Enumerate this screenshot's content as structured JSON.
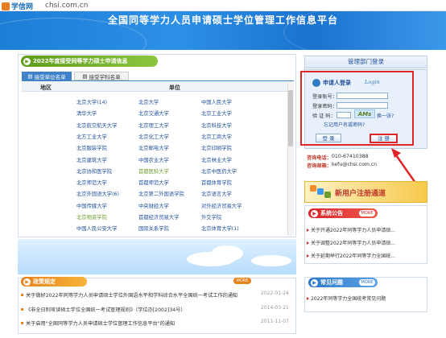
{
  "site": {
    "logo_text": "学信网",
    "domain": "chsi.com.cn"
  },
  "banner": {
    "title": "全国同等学力人员申请硕士学位管理工作信息平台"
  },
  "notice_tab": "2022年度接受同等学力硕士申请信息",
  "tabs": [
    {
      "label": "接受单位名单"
    },
    {
      "label": "接受学科名单"
    }
  ],
  "table": {
    "headers": [
      "地区",
      "单位"
    ],
    "universities": [
      "北京大学(14)",
      "北京大学",
      "中国人民大学",
      "清华大学",
      "北京交通大学",
      "北京工业大学",
      "北京航空航天大学",
      "北京理工大学",
      "北京科技大学",
      "北方工业大学",
      "北京化工大学",
      "北京工商大学",
      "北京服装学院",
      "北京邮电大学",
      "北京印刷学院",
      "北京建筑大学",
      "中国农业大学",
      "北京林业大学",
      "北京协和医学院",
      "首都医科大学",
      "北京中医药大学",
      "北京师范大学",
      "首都师范大学",
      "首都体育学院",
      "北京外国语大学(6)",
      "北京第二外国语学院",
      "北京语言大学",
      "中国传媒大学",
      "中央财经大学",
      "对外经济贸易大学",
      "北京物资学院",
      "首都经济贸易大学",
      "外交学院",
      "中国人民公安大学",
      "国际关系学院",
      "北京体育大学(1)"
    ]
  },
  "policy": {
    "title": "政策规定",
    "more": "MORE",
    "items": [
      {
        "text": "关于做好2022年同等学力人员申请硕士学位外国语水平和学科综合水平全国统一考试工作的通知",
        "date": "2022-01-24"
      },
      {
        "text": "《非全日制攻读硕士学位全国统一考试管理规则》（学位办[2002]34号）",
        "date": "2014-03-21"
      },
      {
        "text": "关于启用\"全国同等学力人员申请硕士学位管理工作信息平台\"的通知",
        "date": "2011-11-07"
      }
    ]
  },
  "login": {
    "header": "管理部门登录",
    "title": "申请人登录",
    "title_en": "Login",
    "account_label": "登录账号：",
    "password_label": "登录密码：",
    "captcha_label": "验 证 码：",
    "captcha_text": "AMs",
    "swap": "换一张?",
    "forgot": "忘记用户名或密码?",
    "login_button": "登 录",
    "register_button": "注 册"
  },
  "contact": {
    "phone_label": "咨询电话：",
    "phone": "010-67410388",
    "email_label": "咨询邮箱：",
    "email": "kefu@chsi.com.cn"
  },
  "register_banner": "新用户注册通道",
  "system_notice": {
    "title": "系统公告",
    "more": "MORE",
    "items": [
      "关于开通2022年同等学力人员申请硕...",
      "关于调整2022年同等学力人员申请硕...",
      "关于延期举行2022年同等学力全国统..."
    ]
  },
  "faq": {
    "title": "常见问题",
    "more": "MORE",
    "items": [
      "2022年同等学力全国统考常见问题"
    ]
  },
  "colors": {
    "brand_blue": "#1f6fb5",
    "highlight_red": "#e0242a",
    "green": "#6d9e2c",
    "orange": "#e8821a"
  }
}
